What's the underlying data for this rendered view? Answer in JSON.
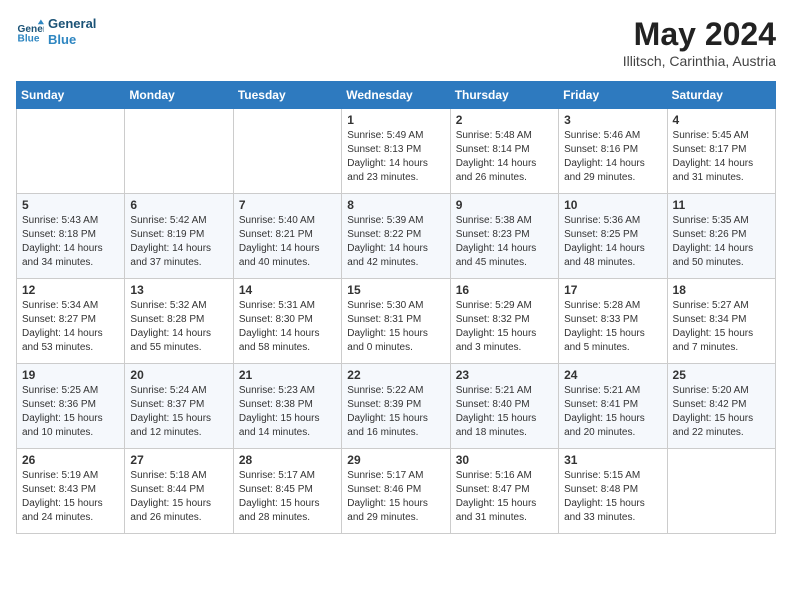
{
  "header": {
    "logo_line1": "General",
    "logo_line2": "Blue",
    "month_year": "May 2024",
    "location": "Illitsch, Carinthia, Austria"
  },
  "weekdays": [
    "Sunday",
    "Monday",
    "Tuesday",
    "Wednesday",
    "Thursday",
    "Friday",
    "Saturday"
  ],
  "weeks": [
    [
      {
        "day": "",
        "text": ""
      },
      {
        "day": "",
        "text": ""
      },
      {
        "day": "",
        "text": ""
      },
      {
        "day": "1",
        "text": "Sunrise: 5:49 AM\nSunset: 8:13 PM\nDaylight: 14 hours\nand 23 minutes."
      },
      {
        "day": "2",
        "text": "Sunrise: 5:48 AM\nSunset: 8:14 PM\nDaylight: 14 hours\nand 26 minutes."
      },
      {
        "day": "3",
        "text": "Sunrise: 5:46 AM\nSunset: 8:16 PM\nDaylight: 14 hours\nand 29 minutes."
      },
      {
        "day": "4",
        "text": "Sunrise: 5:45 AM\nSunset: 8:17 PM\nDaylight: 14 hours\nand 31 minutes."
      }
    ],
    [
      {
        "day": "5",
        "text": "Sunrise: 5:43 AM\nSunset: 8:18 PM\nDaylight: 14 hours\nand 34 minutes."
      },
      {
        "day": "6",
        "text": "Sunrise: 5:42 AM\nSunset: 8:19 PM\nDaylight: 14 hours\nand 37 minutes."
      },
      {
        "day": "7",
        "text": "Sunrise: 5:40 AM\nSunset: 8:21 PM\nDaylight: 14 hours\nand 40 minutes."
      },
      {
        "day": "8",
        "text": "Sunrise: 5:39 AM\nSunset: 8:22 PM\nDaylight: 14 hours\nand 42 minutes."
      },
      {
        "day": "9",
        "text": "Sunrise: 5:38 AM\nSunset: 8:23 PM\nDaylight: 14 hours\nand 45 minutes."
      },
      {
        "day": "10",
        "text": "Sunrise: 5:36 AM\nSunset: 8:25 PM\nDaylight: 14 hours\nand 48 minutes."
      },
      {
        "day": "11",
        "text": "Sunrise: 5:35 AM\nSunset: 8:26 PM\nDaylight: 14 hours\nand 50 minutes."
      }
    ],
    [
      {
        "day": "12",
        "text": "Sunrise: 5:34 AM\nSunset: 8:27 PM\nDaylight: 14 hours\nand 53 minutes."
      },
      {
        "day": "13",
        "text": "Sunrise: 5:32 AM\nSunset: 8:28 PM\nDaylight: 14 hours\nand 55 minutes."
      },
      {
        "day": "14",
        "text": "Sunrise: 5:31 AM\nSunset: 8:30 PM\nDaylight: 14 hours\nand 58 minutes."
      },
      {
        "day": "15",
        "text": "Sunrise: 5:30 AM\nSunset: 8:31 PM\nDaylight: 15 hours\nand 0 minutes."
      },
      {
        "day": "16",
        "text": "Sunrise: 5:29 AM\nSunset: 8:32 PM\nDaylight: 15 hours\nand 3 minutes."
      },
      {
        "day": "17",
        "text": "Sunrise: 5:28 AM\nSunset: 8:33 PM\nDaylight: 15 hours\nand 5 minutes."
      },
      {
        "day": "18",
        "text": "Sunrise: 5:27 AM\nSunset: 8:34 PM\nDaylight: 15 hours\nand 7 minutes."
      }
    ],
    [
      {
        "day": "19",
        "text": "Sunrise: 5:25 AM\nSunset: 8:36 PM\nDaylight: 15 hours\nand 10 minutes."
      },
      {
        "day": "20",
        "text": "Sunrise: 5:24 AM\nSunset: 8:37 PM\nDaylight: 15 hours\nand 12 minutes."
      },
      {
        "day": "21",
        "text": "Sunrise: 5:23 AM\nSunset: 8:38 PM\nDaylight: 15 hours\nand 14 minutes."
      },
      {
        "day": "22",
        "text": "Sunrise: 5:22 AM\nSunset: 8:39 PM\nDaylight: 15 hours\nand 16 minutes."
      },
      {
        "day": "23",
        "text": "Sunrise: 5:21 AM\nSunset: 8:40 PM\nDaylight: 15 hours\nand 18 minutes."
      },
      {
        "day": "24",
        "text": "Sunrise: 5:21 AM\nSunset: 8:41 PM\nDaylight: 15 hours\nand 20 minutes."
      },
      {
        "day": "25",
        "text": "Sunrise: 5:20 AM\nSunset: 8:42 PM\nDaylight: 15 hours\nand 22 minutes."
      }
    ],
    [
      {
        "day": "26",
        "text": "Sunrise: 5:19 AM\nSunset: 8:43 PM\nDaylight: 15 hours\nand 24 minutes."
      },
      {
        "day": "27",
        "text": "Sunrise: 5:18 AM\nSunset: 8:44 PM\nDaylight: 15 hours\nand 26 minutes."
      },
      {
        "day": "28",
        "text": "Sunrise: 5:17 AM\nSunset: 8:45 PM\nDaylight: 15 hours\nand 28 minutes."
      },
      {
        "day": "29",
        "text": "Sunrise: 5:17 AM\nSunset: 8:46 PM\nDaylight: 15 hours\nand 29 minutes."
      },
      {
        "day": "30",
        "text": "Sunrise: 5:16 AM\nSunset: 8:47 PM\nDaylight: 15 hours\nand 31 minutes."
      },
      {
        "day": "31",
        "text": "Sunrise: 5:15 AM\nSunset: 8:48 PM\nDaylight: 15 hours\nand 33 minutes."
      },
      {
        "day": "",
        "text": ""
      }
    ]
  ]
}
